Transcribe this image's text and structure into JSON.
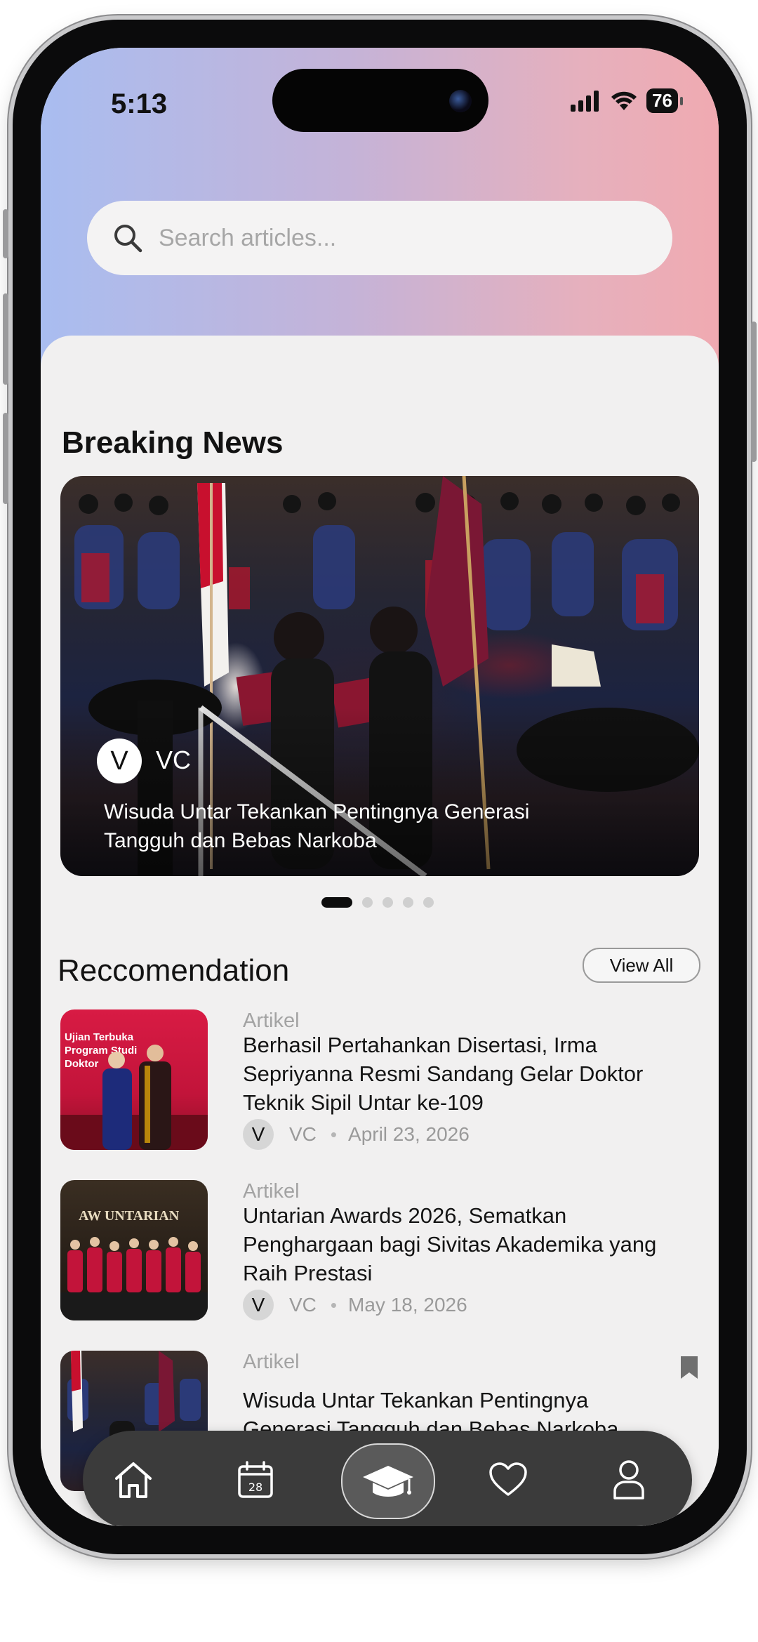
{
  "status_bar": {
    "time": "5:13",
    "battery": "76"
  },
  "search": {
    "placeholder": "Search articles..."
  },
  "breaking": {
    "heading": "Breaking News",
    "slide": {
      "avatar_letter": "V",
      "author": "VC",
      "title": "Wisuda Untar Tekankan Pentingnya Generasi Tangguh dan Bebas Narkoba"
    },
    "page_count": 5,
    "active_index": 0
  },
  "recommendation": {
    "heading": "Reccomendation",
    "view_all": "View All",
    "items": [
      {
        "category": "Artikel",
        "title": "Berhasil Pertahankan Disertasi, Irma Sepriyanna Resmi Sandang Gelar Doktor Teknik Sipil Untar ke-109",
        "avatar_letter": "V",
        "author": "VC",
        "separator": "•",
        "date": "April 23, 2026",
        "thumb_text": "Ujian Terbuka Program Studi Doktor",
        "bookmarked": false
      },
      {
        "category": "Artikel",
        "title": "Untarian Awards 2026, Sematkan Penghargaan bagi Sivitas Akademika yang Raih Prestasi",
        "avatar_letter": "V",
        "author": "VC",
        "separator": "•",
        "date": "May 18, 2026",
        "thumb_text": "AW UNTARIAN",
        "bookmarked": false
      },
      {
        "category": "Artikel",
        "title": "Wisuda Untar Tekankan Pentingnya Generasi Tangguh dan Bebas Narkoba",
        "bookmarked": true
      }
    ]
  },
  "tabbar": {
    "calendar_day": "28",
    "tabs": [
      {
        "icon": "home-icon",
        "active": false
      },
      {
        "icon": "calendar-icon",
        "active": false
      },
      {
        "icon": "graduation-cap-icon",
        "active": true
      },
      {
        "icon": "heart-icon",
        "active": false
      },
      {
        "icon": "profile-icon",
        "active": false
      }
    ]
  },
  "colors": {
    "gradient_left": "#a9bdf0",
    "gradient_right": "#f0aab1",
    "tabbar": "#3b3b3b",
    "background": "#f1f0f0"
  }
}
